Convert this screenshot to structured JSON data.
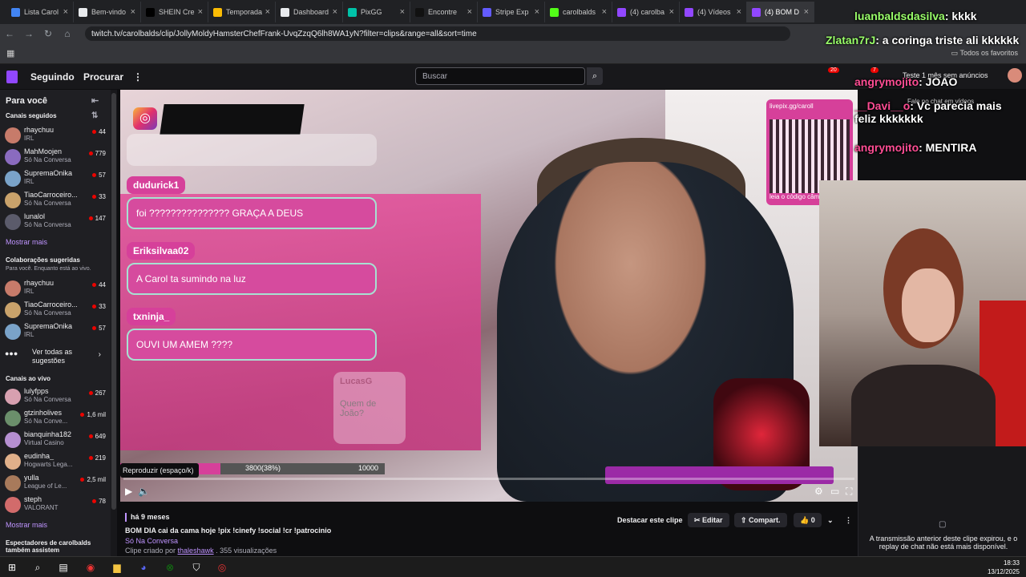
{
  "browser": {
    "tabs": [
      {
        "title": "Lista Carol",
        "color": "#4285f4"
      },
      {
        "title": "Bem-vindo",
        "color": "#e8eaed"
      },
      {
        "title": "SHEIN Cre",
        "color": "#000000"
      },
      {
        "title": "Temporada",
        "color": "#fbbc04"
      },
      {
        "title": "Dashboard",
        "color": "#e8eaed"
      },
      {
        "title": "PixGG",
        "color": "#00c2a8"
      },
      {
        "title": "Encontre",
        "color": "#111111"
      },
      {
        "title": "Stripe Exp",
        "color": "#635bff"
      },
      {
        "title": "carolbalds",
        "color": "#53fc18"
      },
      {
        "title": "(4) carolba",
        "color": "#9147ff"
      },
      {
        "title": "(4) Vídeos",
        "color": "#9147ff"
      },
      {
        "title": "(4) BOM D",
        "color": "#9147ff"
      }
    ],
    "url": "twitch.tv/carolbalds/clip/JollyMoldyHamsterChefFrank-UvqZzqQ6lh8WA1yN?filter=clips&range=all&sort=time",
    "favorites_label": "Todos os favoritos"
  },
  "nav": {
    "following": "Seguindo",
    "browse": "Procurar",
    "search_placeholder": "Buscar",
    "notif_count": "20",
    "inbox_count": "7",
    "turbo": "Teste 1 mês sem anúncios"
  },
  "sidebar": {
    "for_you": "Para você",
    "followed_title": "Canais seguidos",
    "followed": [
      {
        "name": "rhaychuu",
        "game": "IRL",
        "viewers": "44",
        "color": "#c77b6a"
      },
      {
        "name": "MahMoojen",
        "game": "Só Na Conversa",
        "viewers": "779",
        "color": "#8a6bbf"
      },
      {
        "name": "SupremaOnika",
        "game": "IRL",
        "viewers": "57",
        "color": "#7aa3c9"
      },
      {
        "name": "TiaoCarroceiro...",
        "game": "Só Na Conversa",
        "viewers": "33",
        "color": "#c9a26b"
      },
      {
        "name": "lunalol",
        "game": "Só Na Conversa",
        "viewers": "147",
        "color": "#5b5b6b"
      }
    ],
    "show_more_1": "Mostrar mais",
    "suggested_title": "Colaborações sugeridas",
    "suggested_sub": "Para você. Enquanto está ao vivo.",
    "suggested": [
      {
        "name": "rhaychuu",
        "game": "IRL",
        "viewers": "44",
        "color": "#c77b6a"
      },
      {
        "name": "TiaoCarroceiro...",
        "game": "Só Na Conversa",
        "viewers": "33",
        "color": "#c9a26b"
      },
      {
        "name": "SupremaOnika",
        "game": "IRL",
        "viewers": "57",
        "color": "#7aa3c9"
      }
    ],
    "see_all": "Ver todas as sugestões",
    "live_title": "Canais ao vivo",
    "live": [
      {
        "name": "lulyfpps",
        "game": "Só Na Conversa",
        "viewers": "267",
        "color": "#d8a0b0"
      },
      {
        "name": "gtzinholives",
        "game": "Só Na Conve...",
        "viewers": "1,6 mil",
        "color": "#6b8f6b"
      },
      {
        "name": "bianquinha182",
        "game": "Virtual Casino",
        "viewers": "649",
        "color": "#b58fd1"
      },
      {
        "name": "eudinha_",
        "game": "Hogwarts Lega...",
        "viewers": "219",
        "color": "#e0b08a"
      },
      {
        "name": "yulla",
        "game": "League of Le...",
        "viewers": "2,5 mil",
        "color": "#a87a5b"
      },
      {
        "name": "steph",
        "game": "VALORANT",
        "viewers": "78",
        "color": "#d26b6b"
      }
    ],
    "show_more_2": "Mostrar mais",
    "viewers_title": "Espectadores de carolbalds também assistem"
  },
  "video": {
    "chat": [
      {
        "user": "dudurick1",
        "msg": "foi ??????????????? GRAÇA A DEUS"
      },
      {
        "user": "Eriksilvaa02",
        "msg": "A Carol ta sumindo na luz"
      },
      {
        "user": "txninja_",
        "msg": "OUVI UM AMEM ????"
      }
    ],
    "ghost_user": "LucasG",
    "ghost_msg": "Quem de João?",
    "qr_link": "livepix.gg/caroll",
    "qr_text": "leia o código câmera do ce",
    "goal_text": "3800(38%)",
    "goal_target": "10000",
    "goal_progress": 0.38,
    "tooltip": "Reproduzir (espaço/k)"
  },
  "overlay_chat": [
    {
      "user": "luanbaldsdasilva",
      "msg": ": kkkk",
      "color": "#9aff6a"
    },
    {
      "user": "Zlatan7rJ",
      "msg": ": a coringa triste ali kkkkkk",
      "color": "#9aff6a"
    },
    {
      "user": "angrymojito",
      "msg": ": JOAO",
      "color": "#ff4d94"
    },
    {
      "user": "__Davi__o",
      "msg": ": Vc parecia mais feliz kkkkkkk",
      "color": "#ff4d94"
    },
    {
      "user": "angrymojito",
      "msg": ": MENTIRA",
      "color": "#ff4d94"
    }
  ],
  "chat_header": "Fale no chat em vídeos",
  "clip": {
    "ago": "há 9 meses",
    "title": "BOM DIA cai da cama hoje !pix !cinefy !social !cr !patrocinio",
    "category": "Só Na Conversa",
    "created_prefix": "Clipe criado por",
    "creator": "thaleshawk",
    "views": ". 355 visualizações",
    "highlight": "Destacar este clipe",
    "edit": "Editar",
    "share": "Compart.",
    "likes": "0"
  },
  "right_panel": {
    "message": "A transmissão anterior deste clipe expirou, e o replay de chat não está mais disponível."
  },
  "clock": {
    "time": "18:33",
    "date": "13/12/2025"
  }
}
